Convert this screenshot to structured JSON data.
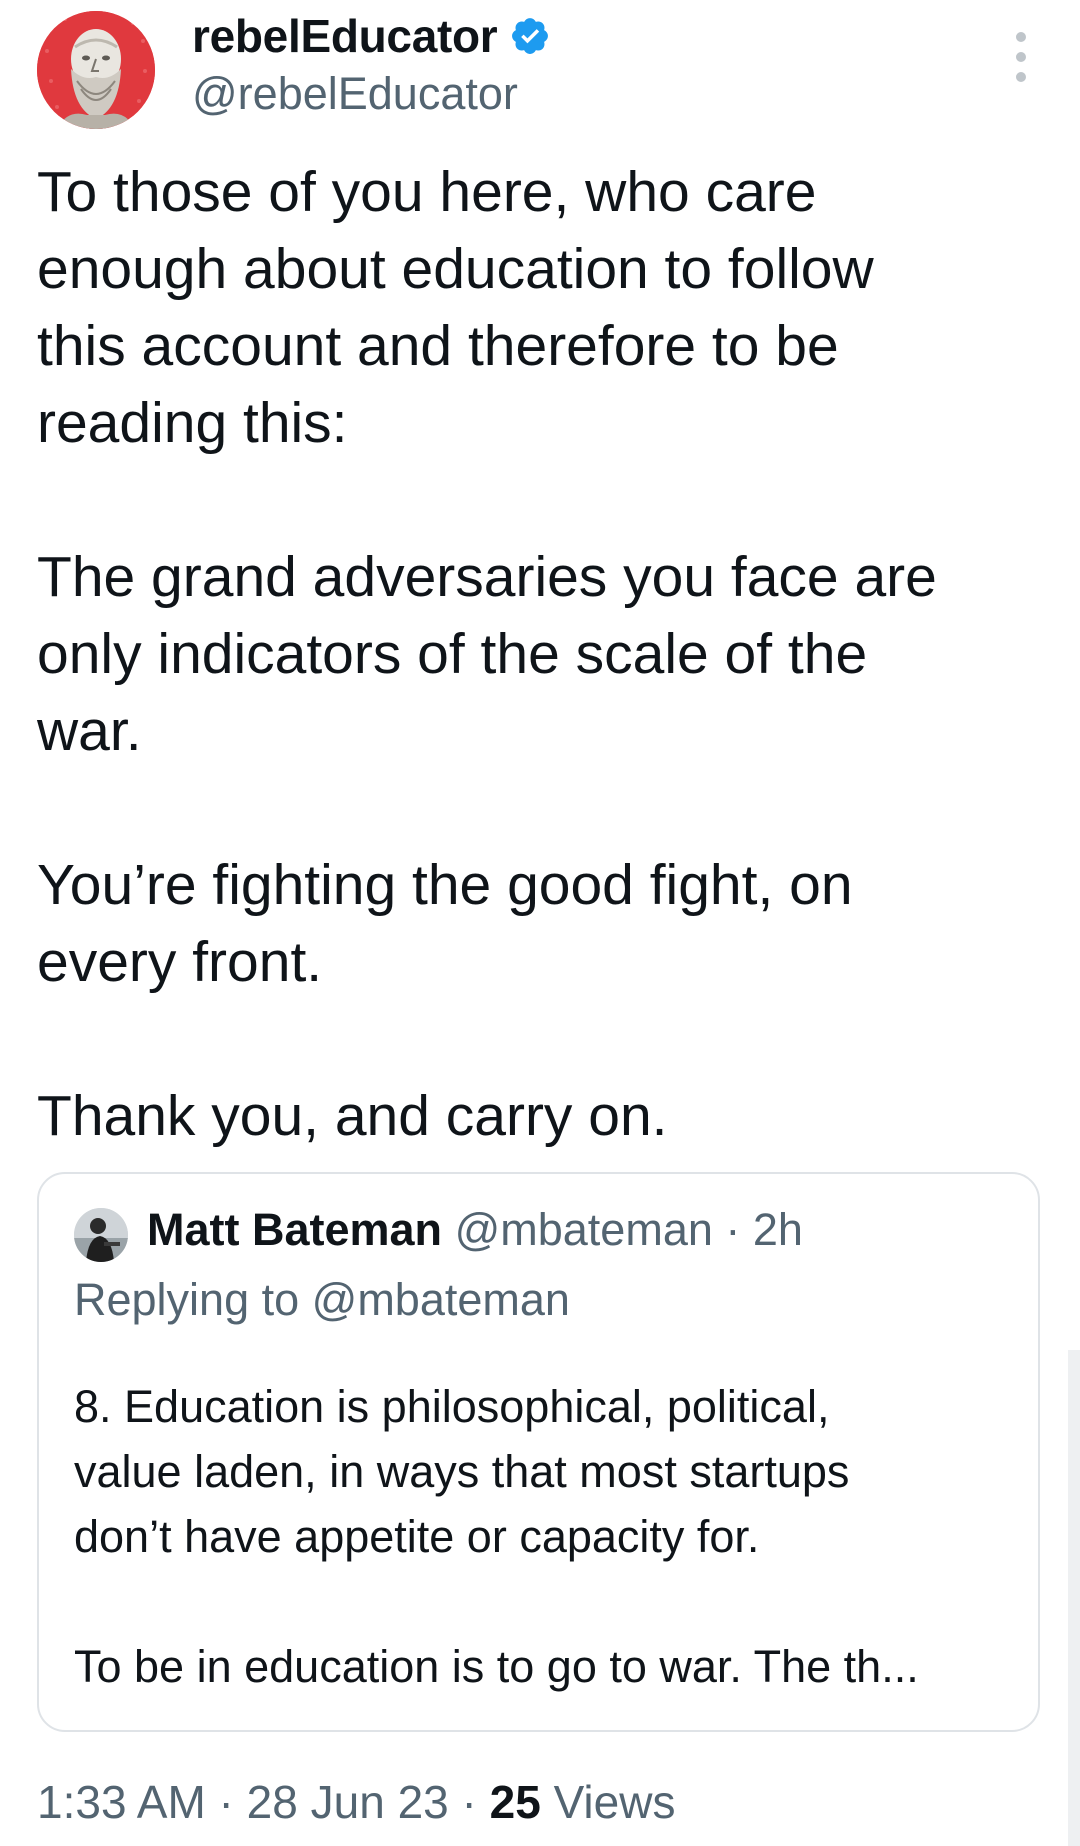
{
  "author": {
    "display_name": "rebelEducator",
    "handle": "@rebelEducator",
    "verified": true,
    "avatar_icon": "socrates-bust-avatar",
    "avatar_color": "#e0393e"
  },
  "tweet": {
    "paragraphs": [
      "To those of you here, who care\nenough about education to follow\nthis account and therefore to be\nreading this:",
      "The grand adversaries you face are\nonly indicators of the scale of the\nwar.",
      "You’re fighting the good fight, on\nevery front.",
      "Thank you, and carry on."
    ]
  },
  "quoted_tweet": {
    "display_name": "Matt Bateman",
    "handle": "@mbateman",
    "separator": " · ",
    "age": "2h",
    "replying_to": "Replying to @mbateman",
    "paragraphs": [
      "8. Education is philosophical, political,\nvalue laden, in ways that most startups\ndon’t have appetite or capacity for.",
      "To be in education is to go to war. The th..."
    ]
  },
  "meta": {
    "time": "1:33 AM",
    "sep": " · ",
    "date": "28 Jun 23",
    "views_count": "25",
    "views_label": " Views"
  },
  "colors": {
    "verified_blue": "#1d9bf0",
    "text": "#0f1419",
    "secondary": "#536471",
    "border": "#dfe3e7"
  }
}
